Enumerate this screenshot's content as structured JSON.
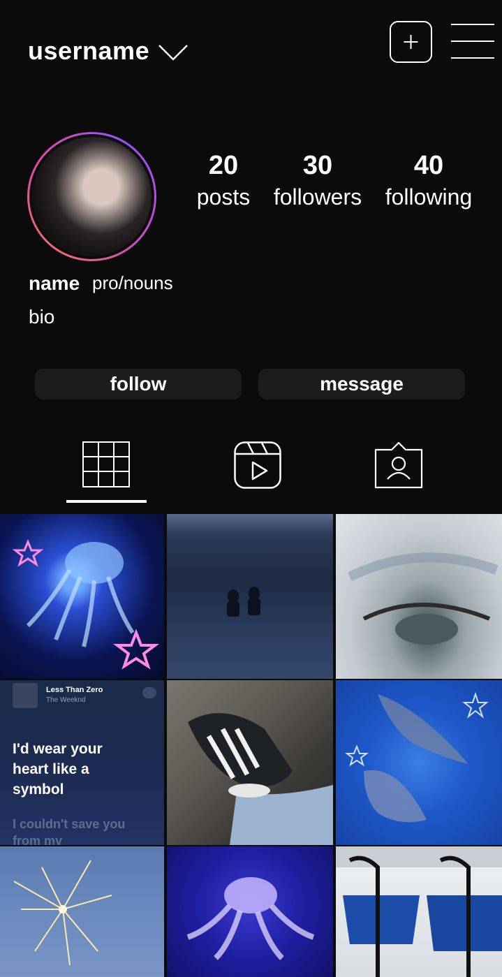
{
  "header": {
    "username": "username",
    "chevron_icon": "chevron-down-icon",
    "add_icon": "plus-square-icon",
    "menu_icon": "hamburger-menu-icon"
  },
  "profile": {
    "avatar_icon": "profile-photo",
    "ring_colors": [
      "#f06b6b",
      "#e04aa8",
      "#9f50ff"
    ],
    "stats": {
      "posts": {
        "value": "20",
        "label": "posts"
      },
      "followers": {
        "value": "30",
        "label": "followers"
      },
      "following": {
        "value": "40",
        "label": "following"
      }
    },
    "name": "name",
    "pronouns": "pro/nouns",
    "bio": "bio"
  },
  "actions": {
    "follow": "follow",
    "message": "message"
  },
  "tabs": [
    {
      "name": "posts-grid",
      "icon": "grid-icon",
      "selected": true
    },
    {
      "name": "reels",
      "icon": "reels-icon",
      "selected": false
    },
    {
      "name": "tagged",
      "icon": "tagged-person-icon",
      "selected": false
    }
  ],
  "posts": [
    {
      "subject": "jellyfish-neon-stars"
    },
    {
      "subject": "sea-silhouettes"
    },
    {
      "subject": "eye-makeup"
    },
    {
      "subject": "lyrics-screenshot",
      "song_title": "Less Than Zero",
      "artist": "The Weeknd",
      "lyric_main": "I'd wear your heart like a symbol",
      "lyric_faded": "I couldn't save you from my"
    },
    {
      "subject": "sneakers"
    },
    {
      "subject": "manta-rays-stars"
    },
    {
      "subject": "fireworks"
    },
    {
      "subject": "jellyfish-glow"
    },
    {
      "subject": "blue-chairs"
    }
  ],
  "colors": {
    "background": "#0c0b0c",
    "button_bg": "#1c1b1d",
    "text": "#ffffff"
  }
}
